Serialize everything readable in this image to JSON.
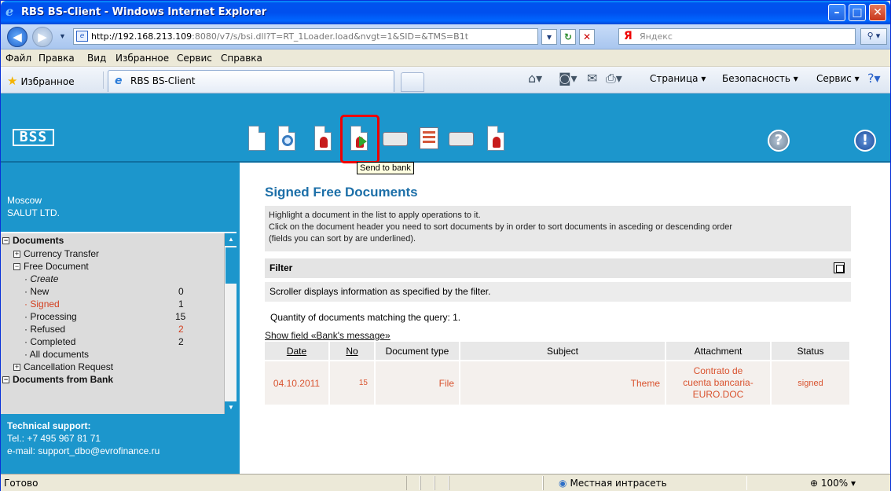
{
  "window": {
    "title": "RBS BS-Client - Windows Internet Explorer",
    "minimize": "–",
    "maximize": "□",
    "close": "✕"
  },
  "address": {
    "url_host": "http://192.168.213.109",
    "url_rest": ":8080/v7/s/bsi.dll?T=RT_1Loader.load&nvgt=1&SID=&TMS=B1t",
    "search_logo": "Я",
    "search_placeholder": "Яндекс"
  },
  "menu": [
    "Файл",
    "Правка",
    "Вид",
    "Избранное",
    "Сервис",
    "Справка"
  ],
  "favbar": {
    "favorites_label": "Избранное",
    "tab_title": "RBS BS-Client",
    "cmd_page": "Страница ▾",
    "cmd_security": "Безопасность ▾",
    "cmd_service": "Сервис ▾"
  },
  "app": {
    "logo": "BSS",
    "tooltip": "Send to bank",
    "org_city": "Moscow",
    "org_name": "SALUT LTD."
  },
  "tree": {
    "documents": "Documents",
    "currency_transfer": "Currency Transfer",
    "free_document": "Free Document",
    "create": "Create",
    "new": "New",
    "new_count": "0",
    "signed": "Signed",
    "signed_count": "1",
    "processing": "Processing",
    "processing_count": "15",
    "refused": "Refused",
    "refused_count": "2",
    "completed": "Completed",
    "completed_count": "2",
    "all_documents": "All documents",
    "cancellation_request": "Cancellation Request",
    "documents_from_bank": "Documents from Bank"
  },
  "support": {
    "title": "Technical support:",
    "tel": "Tel.: +7 495 967 81 71",
    "email": "e-mail: support_dbo@evrofinance.ru"
  },
  "main": {
    "title": "Signed Free Documents",
    "info_line1": "Highlight a document in the list to apply operations to it.",
    "info_line2": "Click on the document header you need to sort documents by in order to sort documents in asceding or descending order",
    "info_line3": "(fields you can sort by are underlined).",
    "filter_label": "Filter",
    "scroller_note": "Scroller displays information as specified by the filter.",
    "quantity": "Quantity  of documents  matching the query:  1.",
    "show_field": "Show field «Bank's message»",
    "columns": {
      "date": "Date",
      "no": "No",
      "doctype": "Document type",
      "subject": "Subject",
      "attachment": "Attachment",
      "status": "Status"
    },
    "row": {
      "date": "04.10.2011",
      "no": "15",
      "doctype": "File",
      "subject": "Theme",
      "attachment_l1": "Contrato de",
      "attachment_l2": "cuenta bancaria-",
      "attachment_l3": "EURO.DOC",
      "status": "signed"
    }
  },
  "statusbar": {
    "ready": "Готово",
    "zone": "Местная интрасеть",
    "zoom": "100%"
  }
}
